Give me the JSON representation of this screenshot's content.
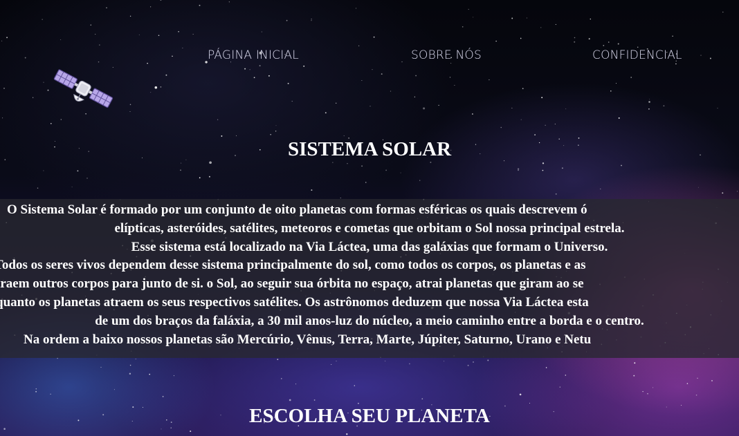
{
  "nav": {
    "items": [
      {
        "label": "PÁGINA INICIAL"
      },
      {
        "label": "SOBRE NÓS"
      },
      {
        "label": "CONFIDENCIAL"
      }
    ]
  },
  "logo": {
    "icon": "satellite-icon"
  },
  "main": {
    "title": "SISTEMA SOLAR",
    "intro_lines": [
      "O Sistema Solar é formado por um conjunto de oito planetas com formas esféricas os quais descrevem ó",
      "elípticas, asteróides, satélites, meteoros e cometas que orbitam o Sol nossa principal estrela.",
      "Esse sistema está localizado na Via Láctea, uma das galáxias que formam o Universo.",
      "Todos os seres vivos dependem desse sistema principalmente do sol, como todos os corpos, os planetas e as",
      "traem outros corpos para junto de si. o Sol, ao seguir sua órbita no espaço, atrai planetas que giram ao se",
      "quanto os planetas atraem os seus respectivos satélites. Os astrônomos deduzem que nossa Via Láctea esta",
      "de um dos braços da faláxia, a 30 mil anos-luz do núcleo, a meio caminho entre a borda e o centro.",
      "Na ordem a baixo nossos planetas são Mercúrio, Vênus, Terra, Marte, Júpiter, Saturno, Urano e Netu"
    ],
    "subtitle": "ESCOLHA SEU PLANETA"
  },
  "colors": {
    "nav_text": "#dcdcf0",
    "heading_text": "#ffffff",
    "intro_background": "#28282f"
  }
}
